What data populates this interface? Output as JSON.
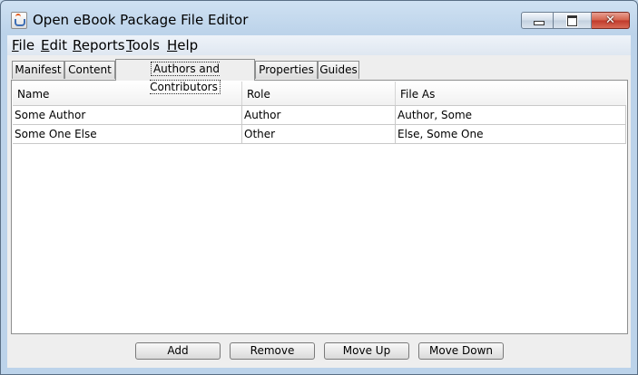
{
  "window": {
    "title": "Open eBook Package File Editor",
    "icon": "java-cup-icon",
    "controls": {
      "minimize": "minimize-icon",
      "maximize": "maximize-icon",
      "close": "✕"
    }
  },
  "menubar": {
    "items": [
      {
        "mnemonic": "F",
        "rest": "ile"
      },
      {
        "mnemonic": "E",
        "rest": "dit"
      },
      {
        "mnemonic": "R",
        "rest": "eports"
      },
      {
        "mnemonic": "T",
        "rest": "ools"
      },
      {
        "mnemonic": "H",
        "rest": "elp"
      }
    ]
  },
  "tabs": [
    {
      "label": "Manifest"
    },
    {
      "label": "Content"
    },
    {
      "label": "Authors and Contributors",
      "active": true
    },
    {
      "label": "Properties"
    },
    {
      "label": "Guides"
    }
  ],
  "table": {
    "columns": [
      "Name",
      "Role",
      "File As"
    ],
    "rows": [
      [
        "Some Author",
        "Author",
        "Author, Some"
      ],
      [
        "Some One Else",
        "Other",
        "Else, Some One"
      ]
    ]
  },
  "buttons": {
    "add": "Add",
    "remove": "Remove",
    "move_up": "Move Up",
    "move_down": "Move Down"
  }
}
